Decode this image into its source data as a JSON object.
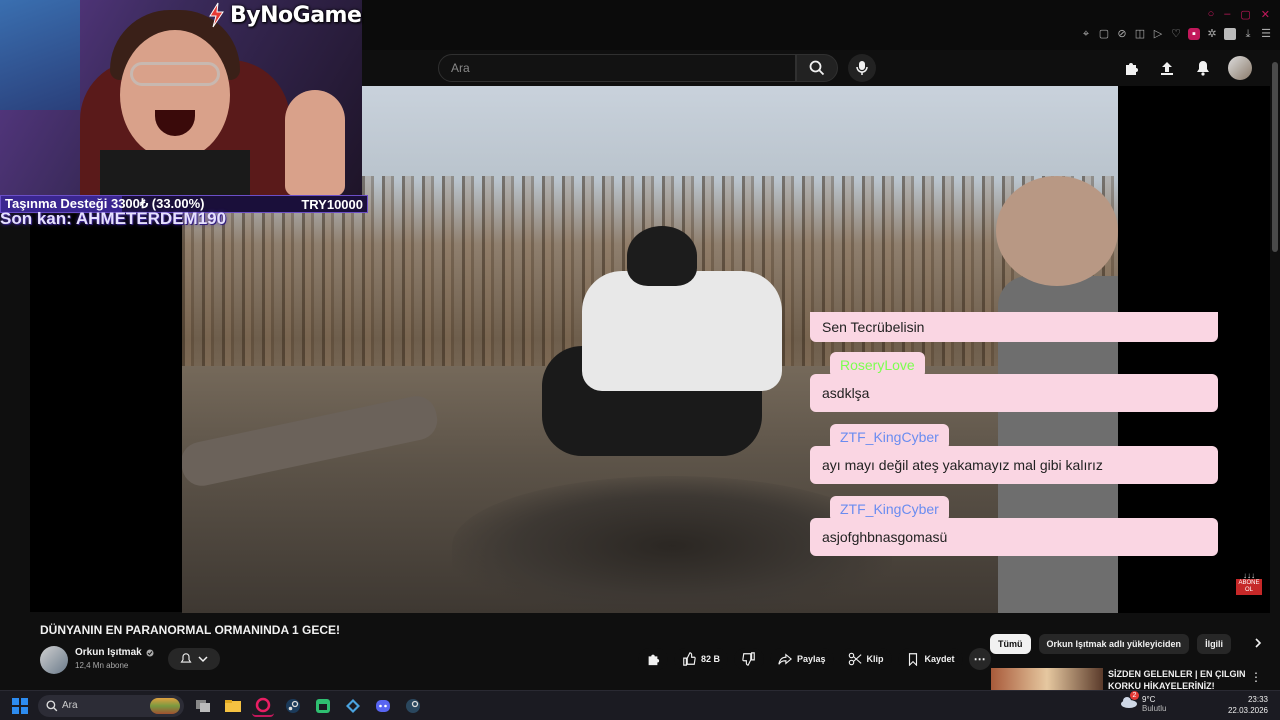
{
  "overlay": {
    "brand": "ByNoGame",
    "donation_left": "Taşınma Desteği 3300₺ (33.00%)",
    "donation_right": "TRY10000",
    "donation_progress": 0.33,
    "donor_line": "Son kan: AHMETERDEM190"
  },
  "header": {
    "search_placeholder": "Ara"
  },
  "chat": {
    "messages": [
      {
        "user": "",
        "text": "Sen Tecrübelisin"
      },
      {
        "user": "RoseryLove",
        "user_color": "#7cff4f",
        "text": "asdklşa"
      },
      {
        "user": "ZTF_KingCyber",
        "user_color": "#6a8cf0",
        "text": "ayı mayı değil ateş yakamayız mal gibi kalırız"
      },
      {
        "user": "ZTF_KingCyber",
        "user_color": "#6a8cf0",
        "text": "asjofghbnasgomasü"
      }
    ]
  },
  "floating_subscribe": "ABONE OL",
  "video": {
    "title": "DÜNYANIN EN PARANORMAL ORMANINDA 1 GECE!",
    "channel": "Orkun Işıtmak",
    "subscribers": "12,4 Mn abone",
    "likes": "82 B",
    "share": "Paylaş",
    "clip": "Klip",
    "save": "Kaydet"
  },
  "chips": [
    "Tümü",
    "Orkun Işıtmak adlı yükleyiciden",
    "İlgili"
  ],
  "recommendation": {
    "title": "SİZDEN GELENLER | EN ÇILGIN KORKU HİKAYELERİNİZ!"
  },
  "taskbar": {
    "search": "Ara",
    "temperature": "9°C",
    "weather": "Bulutlu",
    "time": "23:33",
    "date": "22.03.2026",
    "weather_badge": "2"
  },
  "colors": {
    "accent": "#c2185b",
    "chat_bubble": "#fad6e3",
    "donation_border": "#6b4fc7"
  }
}
